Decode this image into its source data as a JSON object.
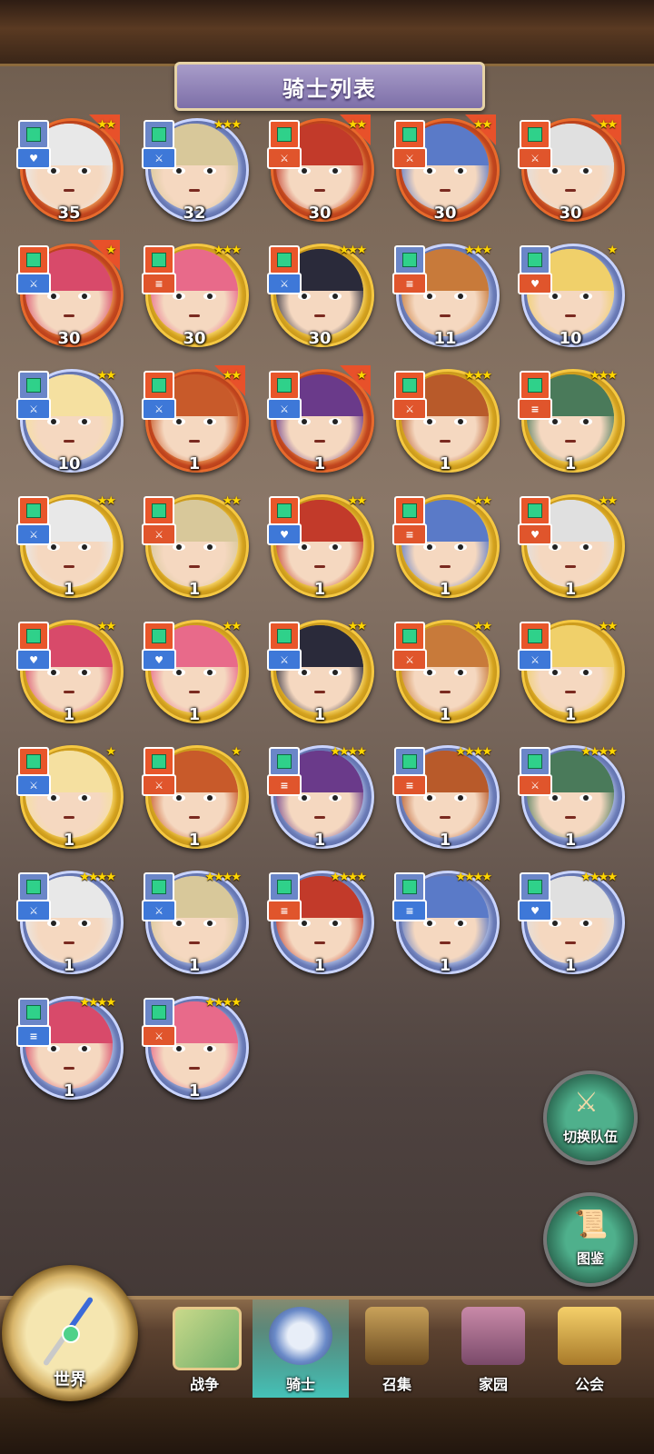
{
  "title": "骑士列表",
  "knights": [
    {
      "level": "35",
      "stars": "★★",
      "frame": "red",
      "cls": "blue",
      "role": "blue",
      "role_icon": "♥",
      "corner": true
    },
    {
      "level": "32",
      "stars": "★★★",
      "frame": "blue",
      "cls": "blue",
      "role": "blue",
      "role_icon": "⚔",
      "corner": false
    },
    {
      "level": "30",
      "stars": "★★",
      "frame": "red",
      "cls": "red",
      "role": "red",
      "role_icon": "⚔",
      "corner": true
    },
    {
      "level": "30",
      "stars": "★★",
      "frame": "red",
      "cls": "red",
      "role": "red",
      "role_icon": "⚔",
      "corner": true
    },
    {
      "level": "30",
      "stars": "★★",
      "frame": "red",
      "cls": "red",
      "role": "red",
      "role_icon": "⚔",
      "corner": true
    },
    {
      "level": "30",
      "stars": "★",
      "frame": "red",
      "cls": "red",
      "role": "blue",
      "role_icon": "⚔",
      "corner": true
    },
    {
      "level": "30",
      "stars": "★★★",
      "frame": "gold",
      "cls": "red",
      "role": "red",
      "role_icon": "≡",
      "corner": false
    },
    {
      "level": "30",
      "stars": "★★★",
      "frame": "gold",
      "cls": "red",
      "role": "blue",
      "role_icon": "⚔",
      "corner": false
    },
    {
      "level": "11",
      "stars": "★★★",
      "frame": "blue",
      "cls": "blue",
      "role": "red",
      "role_icon": "≡",
      "corner": false
    },
    {
      "level": "10",
      "stars": "★",
      "frame": "blue",
      "cls": "blue",
      "role": "red",
      "role_icon": "♥",
      "corner": false
    },
    {
      "level": "10",
      "stars": "★★",
      "frame": "blue",
      "cls": "blue",
      "role": "blue",
      "role_icon": "⚔",
      "corner": false
    },
    {
      "level": "1",
      "stars": "★★",
      "frame": "red",
      "cls": "red",
      "role": "blue",
      "role_icon": "⚔",
      "corner": true
    },
    {
      "level": "1",
      "stars": "★",
      "frame": "red",
      "cls": "red",
      "role": "blue",
      "role_icon": "⚔",
      "corner": true
    },
    {
      "level": "1",
      "stars": "★★★",
      "frame": "gold",
      "cls": "red",
      "role": "red",
      "role_icon": "⚔",
      "corner": false
    },
    {
      "level": "1",
      "stars": "★★★",
      "frame": "gold",
      "cls": "red",
      "role": "red",
      "role_icon": "≡",
      "corner": false
    },
    {
      "level": "1",
      "stars": "★★",
      "frame": "gold",
      "cls": "red",
      "role": "blue",
      "role_icon": "⚔",
      "corner": false
    },
    {
      "level": "1",
      "stars": "★★",
      "frame": "gold",
      "cls": "red",
      "role": "red",
      "role_icon": "⚔",
      "corner": false
    },
    {
      "level": "1",
      "stars": "★★",
      "frame": "gold",
      "cls": "red",
      "role": "blue",
      "role_icon": "♥",
      "corner": false
    },
    {
      "level": "1",
      "stars": "★★",
      "frame": "gold",
      "cls": "red",
      "role": "red",
      "role_icon": "≡",
      "corner": false
    },
    {
      "level": "1",
      "stars": "★★",
      "frame": "gold",
      "cls": "red",
      "role": "red",
      "role_icon": "♥",
      "corner": false
    },
    {
      "level": "1",
      "stars": "★★",
      "frame": "gold",
      "cls": "red",
      "role": "blue",
      "role_icon": "♥",
      "corner": false
    },
    {
      "level": "1",
      "stars": "★★",
      "frame": "gold",
      "cls": "red",
      "role": "blue",
      "role_icon": "♥",
      "corner": false
    },
    {
      "level": "1",
      "stars": "★★",
      "frame": "gold",
      "cls": "red",
      "role": "blue",
      "role_icon": "⚔",
      "corner": false
    },
    {
      "level": "1",
      "stars": "★★",
      "frame": "gold",
      "cls": "red",
      "role": "red",
      "role_icon": "⚔",
      "corner": false
    },
    {
      "level": "1",
      "stars": "★★",
      "frame": "gold",
      "cls": "red",
      "role": "blue",
      "role_icon": "⚔",
      "corner": false
    },
    {
      "level": "1",
      "stars": "★",
      "frame": "gold",
      "cls": "red",
      "role": "blue",
      "role_icon": "⚔",
      "corner": false
    },
    {
      "level": "1",
      "stars": "★",
      "frame": "gold",
      "cls": "red",
      "role": "red",
      "role_icon": "⚔",
      "corner": false
    },
    {
      "level": "1",
      "stars": "★★★★",
      "frame": "blue",
      "cls": "blue",
      "role": "red",
      "role_icon": "≡",
      "corner": false
    },
    {
      "level": "1",
      "stars": "★★★★",
      "frame": "blue",
      "cls": "blue",
      "role": "red",
      "role_icon": "≡",
      "corner": false
    },
    {
      "level": "1",
      "stars": "★★★★",
      "frame": "blue",
      "cls": "blue",
      "role": "red",
      "role_icon": "⚔",
      "corner": false
    },
    {
      "level": "1",
      "stars": "★★★★",
      "frame": "blue",
      "cls": "blue",
      "role": "blue",
      "role_icon": "⚔",
      "corner": false
    },
    {
      "level": "1",
      "stars": "★★★★",
      "frame": "blue",
      "cls": "blue",
      "role": "blue",
      "role_icon": "⚔",
      "corner": false
    },
    {
      "level": "1",
      "stars": "★★★★",
      "frame": "blue",
      "cls": "blue",
      "role": "red",
      "role_icon": "≡",
      "corner": false
    },
    {
      "level": "1",
      "stars": "★★★★",
      "frame": "blue",
      "cls": "blue",
      "role": "blue",
      "role_icon": "≡",
      "corner": false
    },
    {
      "level": "1",
      "stars": "★★★★",
      "frame": "blue",
      "cls": "blue",
      "role": "blue",
      "role_icon": "♥",
      "corner": false
    },
    {
      "level": "1",
      "stars": "★★★★",
      "frame": "blue",
      "cls": "blue",
      "role": "blue",
      "role_icon": "≡",
      "corner": false
    },
    {
      "level": "1",
      "stars": "★★★★",
      "frame": "blue",
      "cls": "blue",
      "role": "red",
      "role_icon": "⚔",
      "corner": false
    }
  ],
  "side_buttons": {
    "switch_team": "切换队伍",
    "codex": "图鉴"
  },
  "nav": {
    "world": "世界",
    "war": "战争",
    "knight": "骑士",
    "summon": "召集",
    "home": "家园",
    "guild": "公会"
  },
  "colors": {
    "accent": "#7d6fa8",
    "active_tab": "#46dcd2",
    "star": "#ffd700"
  }
}
